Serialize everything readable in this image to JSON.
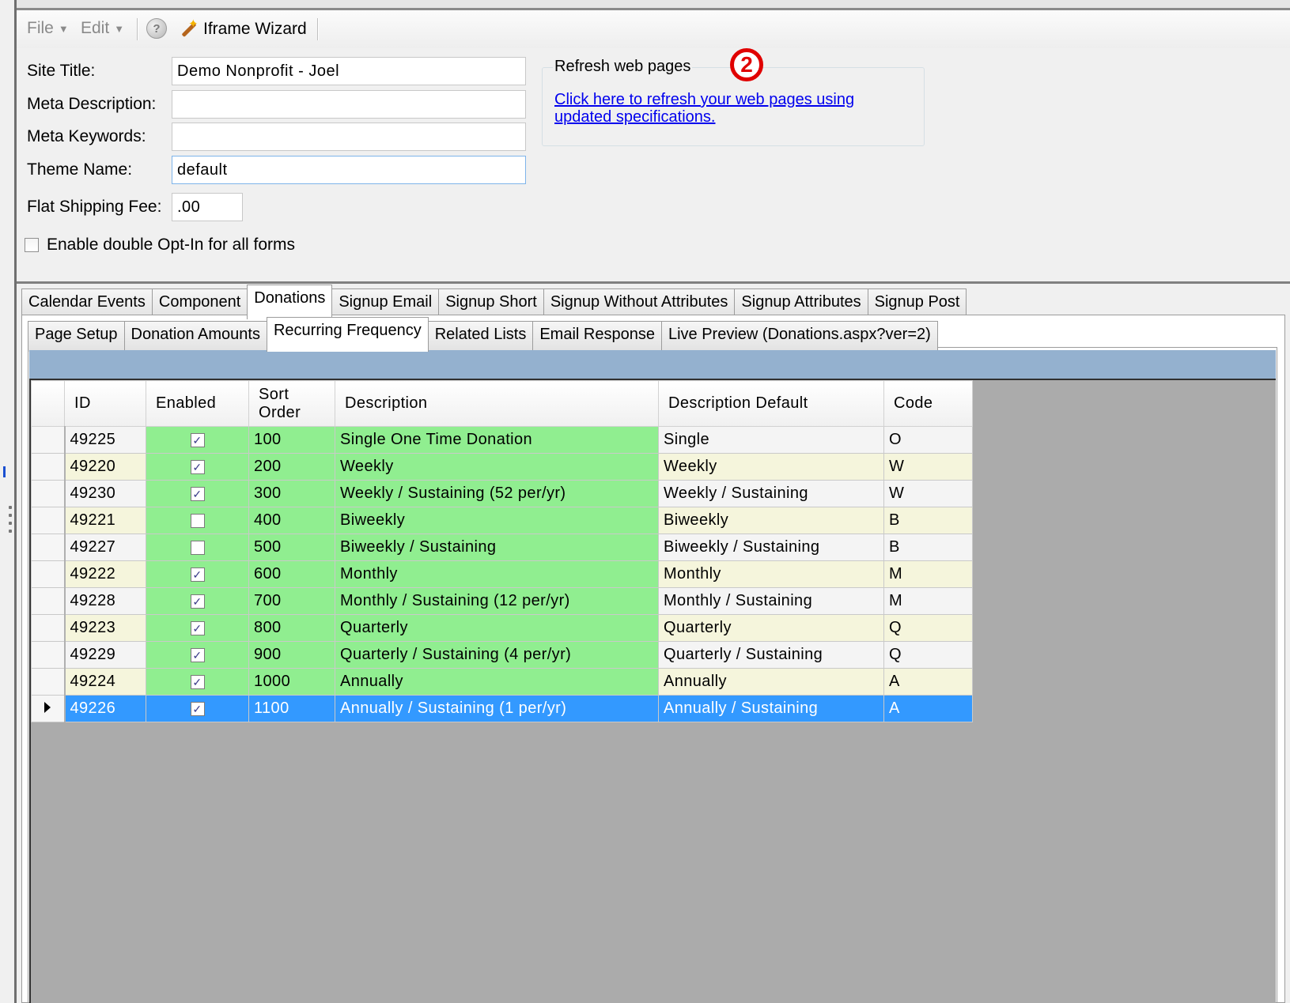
{
  "toolbar": {
    "file_label": "File",
    "edit_label": "Edit",
    "wizard_label": "Iframe Wizard"
  },
  "form": {
    "site_title_label": "Site Title:",
    "site_title_value": "Demo Nonprofit - Joel",
    "meta_description_label": "Meta Description:",
    "meta_description_value": "",
    "meta_keywords_label": "Meta Keywords:",
    "meta_keywords_value": "",
    "theme_name_label": "Theme Name:",
    "theme_name_value": "default",
    "flat_shipping_label": "Flat Shipping Fee:",
    "flat_shipping_value": ".00",
    "double_optin_label": "Enable double Opt-In for all forms",
    "double_optin_checked": false
  },
  "refresh_group": {
    "title": "Refresh web pages",
    "link_text": "Click here to refresh your web pages using updated specifications.",
    "callout_number": "2",
    "callout_color": "#e00000"
  },
  "main_tabs": [
    {
      "label": "Calendar Events",
      "active": false
    },
    {
      "label": "Component",
      "active": false
    },
    {
      "label": "Donations",
      "active": true
    },
    {
      "label": "Signup Email",
      "active": false
    },
    {
      "label": "Signup Short",
      "active": false
    },
    {
      "label": "Signup Without Attributes",
      "active": false
    },
    {
      "label": "Signup Attributes",
      "active": false
    },
    {
      "label": "Signup Post",
      "active": false
    }
  ],
  "sub_tabs": [
    {
      "label": "Page Setup",
      "active": false
    },
    {
      "label": "Donation Amounts",
      "active": false
    },
    {
      "label": "Recurring Frequency",
      "active": true
    },
    {
      "label": "Related Lists",
      "active": false
    },
    {
      "label": "Email Response",
      "active": false
    },
    {
      "label": "Live Preview (Donations.aspx?ver=2)",
      "active": false
    }
  ],
  "grid": {
    "columns": [
      "ID",
      "Enabled",
      "Sort Order",
      "Description",
      "Description Default",
      "Code"
    ],
    "rows": [
      {
        "id": "49225",
        "enabled": true,
        "sort": "100",
        "description": "Single One Time Donation",
        "default": "Single",
        "code": "O"
      },
      {
        "id": "49220",
        "enabled": true,
        "sort": "200",
        "description": "Weekly",
        "default": "Weekly",
        "code": "W"
      },
      {
        "id": "49230",
        "enabled": true,
        "sort": "300",
        "description": "Weekly / Sustaining (52 per/yr)",
        "default": "Weekly / Sustaining",
        "code": "W"
      },
      {
        "id": "49221",
        "enabled": false,
        "sort": "400",
        "description": "Biweekly",
        "default": "Biweekly",
        "code": "B"
      },
      {
        "id": "49227",
        "enabled": false,
        "sort": "500",
        "description": "Biweekly / Sustaining",
        "default": "Biweekly / Sustaining",
        "code": "B"
      },
      {
        "id": "49222",
        "enabled": true,
        "sort": "600",
        "description": "Monthly",
        "default": "Monthly",
        "code": "M"
      },
      {
        "id": "49228",
        "enabled": true,
        "sort": "700",
        "description": "Monthly / Sustaining (12 per/yr)",
        "default": "Monthly / Sustaining",
        "code": "M"
      },
      {
        "id": "49223",
        "enabled": true,
        "sort": "800",
        "description": "Quarterly",
        "default": "Quarterly",
        "code": "Q"
      },
      {
        "id": "49229",
        "enabled": true,
        "sort": "900",
        "description": "Quarterly / Sustaining (4 per/yr)",
        "default": "Quarterly / Sustaining",
        "code": "Q"
      },
      {
        "id": "49224",
        "enabled": true,
        "sort": "1000",
        "description": "Annually",
        "default": "Annually",
        "code": "A"
      },
      {
        "id": "49226",
        "enabled": true,
        "sort": "1100",
        "description": "Annually / Sustaining (1 per/yr)",
        "default": "Annually / Sustaining",
        "code": "A",
        "selected": true
      }
    ]
  },
  "colors": {
    "enabled_cell": "#90ee90",
    "alt_row": "#f5f5dc",
    "selected_row": "#3399ff",
    "header_strip": "#94b1cf",
    "grid_background": "#ababab"
  }
}
